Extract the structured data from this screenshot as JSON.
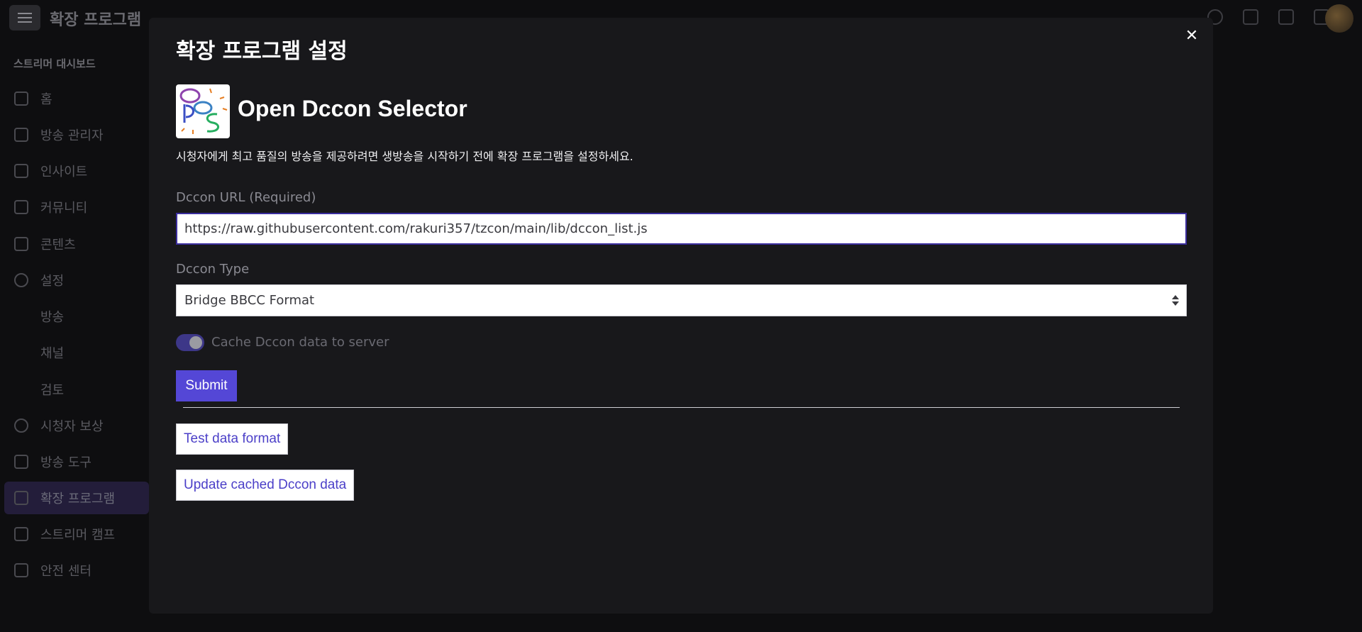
{
  "app": {
    "title": "확장 프로그램",
    "menu_icon": "hamburger-icon"
  },
  "sidebar": {
    "heading": "스트리머 대시보드",
    "items": [
      {
        "label": "홈",
        "icon": "home-icon"
      },
      {
        "label": "방송 관리자",
        "icon": "broadcast-icon"
      },
      {
        "label": "인사이트",
        "icon": "chart-icon"
      },
      {
        "label": "커뮤니티",
        "icon": "community-icon"
      },
      {
        "label": "콘텐츠",
        "icon": "film-icon"
      },
      {
        "label": "설정",
        "icon": "gear-icon"
      },
      {
        "label": "방송"
      },
      {
        "label": "채널"
      },
      {
        "label": "검토"
      },
      {
        "label": "시청자 보상",
        "icon": "smile-icon"
      },
      {
        "label": "방송 도구",
        "icon": "camera-icon"
      },
      {
        "label": "확장 프로그램",
        "icon": "puzzle-icon"
      },
      {
        "label": "스트리머 캠프",
        "icon": "book-icon"
      },
      {
        "label": "안전 센터",
        "icon": "shield-icon"
      }
    ]
  },
  "modal": {
    "title": "확장 프로그램 설정",
    "close_icon": "close-icon",
    "extension_name": "Open Dccon Selector",
    "description": "시청자에게 최고 품질의 방송을 제공하려면 생방송을 시작하기 전에 확장 프로그램을 설정하세요.",
    "url_label": "Dccon URL (Required)",
    "url_value": "https://raw.githubusercontent.com/rakuri357/tzcon/main/lib/dccon_list.js",
    "type_label": "Dccon Type",
    "type_value": "Bridge BBCC Format",
    "cache_label": "Cache Dccon data to server",
    "cache_enabled": true,
    "submit_label": "Submit",
    "test_button_label": "Test data format",
    "update_button_label": "Update cached Dccon data"
  },
  "colors": {
    "accent": "#5447d6",
    "modal_bg": "#18181b",
    "page_bg": "#0e0e10"
  }
}
